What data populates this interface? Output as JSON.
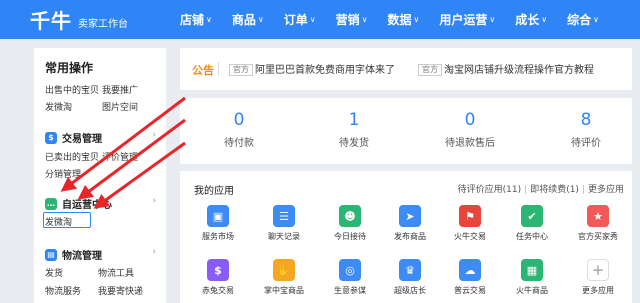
{
  "header": {
    "logo_text": "千牛",
    "logo_sub": "卖家工作台",
    "nav": [
      {
        "label": "店铺"
      },
      {
        "label": "商品"
      },
      {
        "label": "订单"
      },
      {
        "label": "营销"
      },
      {
        "label": "数据"
      },
      {
        "label": "用户运营"
      },
      {
        "label": "成长"
      },
      {
        "label": "综合"
      }
    ],
    "chevron": "∨",
    "bg_color": "#2f84f6"
  },
  "sidebar": {
    "title": "常用操作",
    "quick_links": [
      "出售中的宝贝",
      "我要推广",
      "发微淘",
      "图片空间"
    ],
    "groups": [
      {
        "name": "交易管理",
        "icon": "trade-icon",
        "links": [
          "已卖出的宝贝",
          "评价管理",
          "分销管理"
        ]
      },
      {
        "name": "自运营中心",
        "icon": "chat-icon",
        "links": [
          "发微淘"
        ]
      },
      {
        "name": "物流管理",
        "icon": "logistics-icon",
        "links": [
          "发货",
          "物流工具",
          "物流服务",
          "我要寄快递"
        ]
      }
    ],
    "chevron": "›"
  },
  "notice": {
    "title": "公告",
    "items": [
      {
        "tag": "官方",
        "text": "阿里巴巴首款免费商用字体来了"
      },
      {
        "tag": "官方",
        "text": "淘宝网店铺升级流程操作官方教程"
      }
    ]
  },
  "stats": [
    {
      "value": "0",
      "label": "待付款"
    },
    {
      "value": "1",
      "label": "待发货"
    },
    {
      "value": "0",
      "label": "待退款售后"
    },
    {
      "value": "8",
      "label": "待评价"
    }
  ],
  "apps": {
    "title": "我的应用",
    "links": [
      "待评价应用(11)",
      "即将续费(1)",
      "更多应用"
    ],
    "row1": [
      {
        "label": "服务市场",
        "icon": "market-icon",
        "color": "#3d8cf6",
        "glyph": "▣"
      },
      {
        "label": "聊天记录",
        "icon": "chat-record-icon",
        "color": "#3d8cf6",
        "glyph": "☰"
      },
      {
        "label": "今日接待",
        "icon": "reception-icon",
        "color": "#2bb673",
        "glyph": "☻"
      },
      {
        "label": "发布商品",
        "icon": "publish-icon",
        "color": "#3d8cf6",
        "glyph": "➤"
      },
      {
        "label": "火牛交易",
        "icon": "fire-trade-icon",
        "color": "#e8453c",
        "glyph": "⚑"
      },
      {
        "label": "任务中心",
        "icon": "task-icon",
        "color": "#2bb673",
        "glyph": "✔"
      },
      {
        "label": "官方买家秀",
        "icon": "buyer-show-icon",
        "color": "#f25a5a",
        "glyph": "★"
      }
    ],
    "row2": [
      {
        "label": "赤兔交易",
        "icon": "chitu-icon",
        "color": "#8a5cf6",
        "glyph": "$"
      },
      {
        "label": "掌中宝商品",
        "icon": "palm-icon",
        "color": "#f5a623",
        "glyph": "✋"
      },
      {
        "label": "生意参谋",
        "icon": "advisor-icon",
        "color": "#3d8cf6",
        "glyph": "◎"
      },
      {
        "label": "超级店长",
        "icon": "manager-icon",
        "color": "#3d8cf6",
        "glyph": "♛"
      },
      {
        "label": "普云交易",
        "icon": "puyun-icon",
        "color": "#3d8cf6",
        "glyph": "☁"
      },
      {
        "label": "火牛商品",
        "icon": "fire-goods-icon",
        "color": "#2bb673",
        "glyph": "▦"
      },
      {
        "label": "更多应用",
        "icon": "add-icon",
        "color": "#ffffff",
        "glyph": "+"
      }
    ]
  },
  "annotation_color": "#e8262a"
}
